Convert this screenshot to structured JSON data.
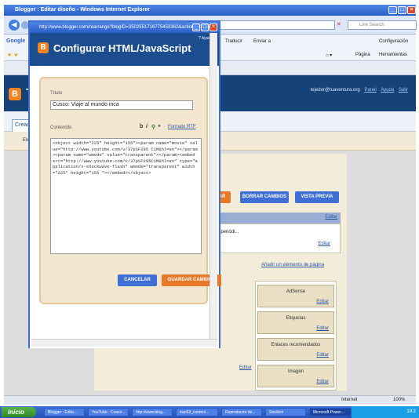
{
  "browser": {
    "title": "Blogger : Editar diseño - Windows Internet Explorer",
    "search_placeholder": "Live Search",
    "google_label": "Google",
    "toolbar_items": [
      "Traducir",
      "Enviar a"
    ],
    "settings_label": "Configuración",
    "page_menu": [
      "Página",
      "Herramientas"
    ],
    "status_zone": "Internet",
    "zoom": "100%"
  },
  "blogger": {
    "logo": "B",
    "logo_text": "T",
    "user_email": "tejedor@tuaventura.org",
    "user_links": [
      "Panel",
      "Ayuda",
      "Salir"
    ],
    "tab_create": "Creac",
    "elements_label": "Elem"
  },
  "layout": {
    "buttons": {
      "save_partial": "AR",
      "clear": "BORRAR CAMBIOS",
      "preview": "VISTA PREVIA"
    },
    "edit_link": "Editar",
    "post_text": "s, periódi...",
    "add_gadget": "Añadir un elemento de página",
    "gadgets": [
      "AdSense",
      "Etiquetas",
      "Enlaces recomendados",
      "Imagen"
    ]
  },
  "popup": {
    "url": "http://www.blogger.com/rearrange?blogID=3502551716775453362&action=editWid...",
    "title": "Configurar HTML/JavaScript",
    "help": "? Ayuda",
    "title_label": "Título",
    "title_value": "Cusco: Viaje al mundo inca",
    "content_label": "Contenido",
    "format_toolbar": "b i ",
    "rich_text": "Formato RTF",
    "content_value": "<object width=\"225\" height=\"155\"><param name=\"movie\" value=\"http://www.youtube.com/v/37pSF295 C1M&hl=en\"></param><param name=\"wmode\" value=\"transparent\"></param><embed src=\"http://www.youtube.com/v/37pSF295C1M&hl=en\" type=\"application/x-shockwave-flash\" wmode=\"transparent\" width=\"225\" height=\"155 \"></embed></object>",
    "cancel": "CANCELAR",
    "save": "GUARDAR CAMBIOS"
  },
  "taskbar": {
    "start": "Inicio",
    "tasks": [
      "Blogger : Edita...",
      "YouTube - Cusco...",
      "http://www.blog...",
      "tran63_conteni...",
      "Reproductor de...",
      "Sesión4",
      "Microsoft Power..."
    ],
    "clock": "19:2"
  },
  "colors": {
    "accent_orange": "#f58220",
    "blogger_blue": "#1c4d8f",
    "button_orange": "#e6782a",
    "button_blue": "#3f6fd4"
  }
}
